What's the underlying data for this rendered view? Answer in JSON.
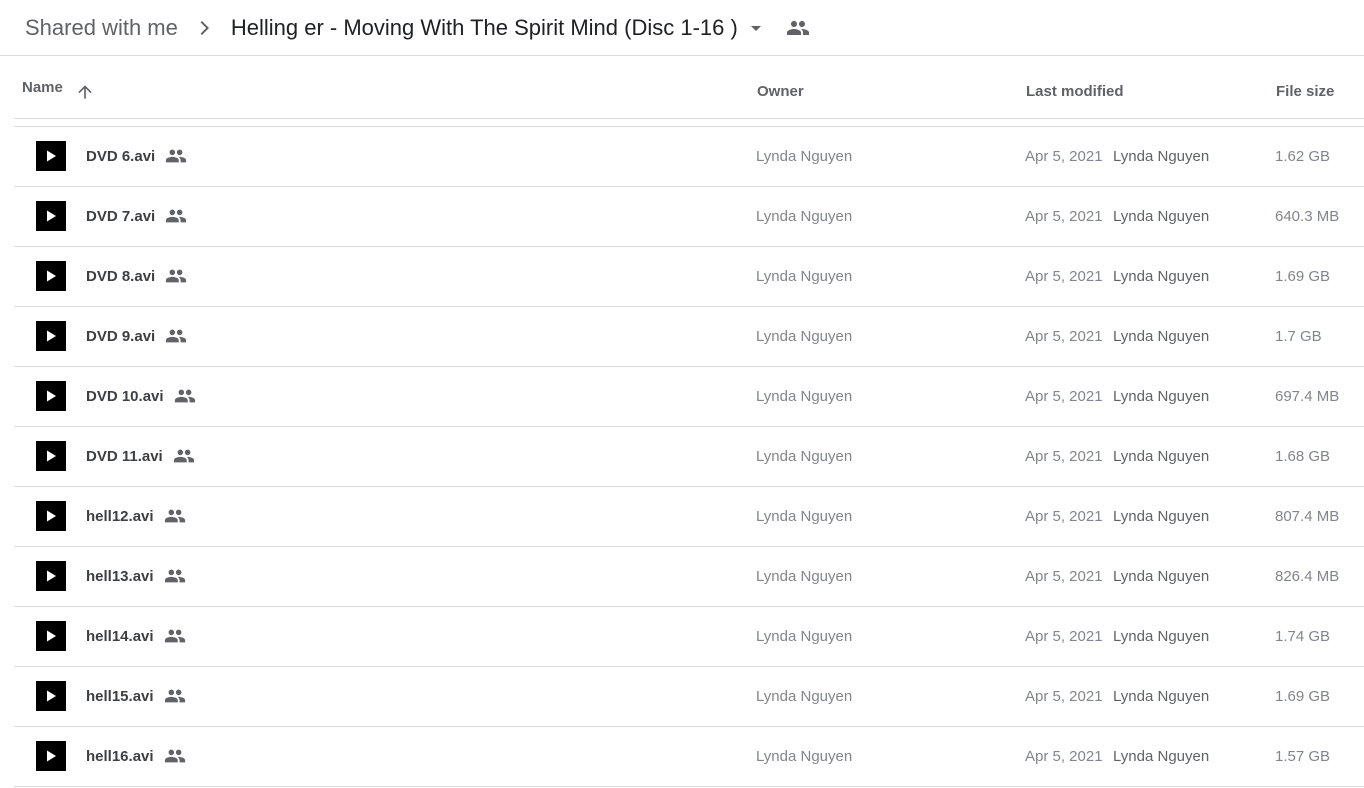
{
  "breadcrumb": {
    "root_label": "Shared with me",
    "current_label": "Helling er - Moving With The Spirit Mind (Disc 1-16 )",
    "separator_icon": "chevron-right-icon",
    "dropdown_icon": "arrow-drop-down-icon",
    "shared_icon": "people-icon"
  },
  "columns": {
    "name": "Name",
    "owner": "Owner",
    "last_modified": "Last modified",
    "file_size": "File size",
    "sort_icon": "arrow-up-icon"
  },
  "files": [
    {
      "name": "DVD 6.avi",
      "owner": "Lynda Nguyen",
      "modified_date": "Apr 5, 2021",
      "modified_by": "Lynda Nguyen",
      "size": "1.62 GB",
      "icon": "video-play-icon"
    },
    {
      "name": "DVD 7.avi",
      "owner": "Lynda Nguyen",
      "modified_date": "Apr 5, 2021",
      "modified_by": "Lynda Nguyen",
      "size": "640.3 MB",
      "icon": "video-play-icon"
    },
    {
      "name": "DVD 8.avi",
      "owner": "Lynda Nguyen",
      "modified_date": "Apr 5, 2021",
      "modified_by": "Lynda Nguyen",
      "size": "1.69 GB",
      "icon": "video-play-icon"
    },
    {
      "name": "DVD 9.avi",
      "owner": "Lynda Nguyen",
      "modified_date": "Apr 5, 2021",
      "modified_by": "Lynda Nguyen",
      "size": "1.7 GB",
      "icon": "video-play-icon"
    },
    {
      "name": "DVD 10.avi",
      "owner": "Lynda Nguyen",
      "modified_date": "Apr 5, 2021",
      "modified_by": "Lynda Nguyen",
      "size": "697.4 MB",
      "icon": "video-play-icon"
    },
    {
      "name": "DVD 11.avi",
      "owner": "Lynda Nguyen",
      "modified_date": "Apr 5, 2021",
      "modified_by": "Lynda Nguyen",
      "size": "1.68 GB",
      "icon": "video-play-icon"
    },
    {
      "name": "hell12.avi",
      "owner": "Lynda Nguyen",
      "modified_date": "Apr 5, 2021",
      "modified_by": "Lynda Nguyen",
      "size": "807.4 MB",
      "icon": "video-play-icon"
    },
    {
      "name": "hell13.avi",
      "owner": "Lynda Nguyen",
      "modified_date": "Apr 5, 2021",
      "modified_by": "Lynda Nguyen",
      "size": "826.4 MB",
      "icon": "video-play-icon"
    },
    {
      "name": "hell14.avi",
      "owner": "Lynda Nguyen",
      "modified_date": "Apr 5, 2021",
      "modified_by": "Lynda Nguyen",
      "size": "1.74 GB",
      "icon": "video-play-icon"
    },
    {
      "name": "hell15.avi",
      "owner": "Lynda Nguyen",
      "modified_date": "Apr 5, 2021",
      "modified_by": "Lynda Nguyen",
      "size": "1.69 GB",
      "icon": "video-play-icon"
    },
    {
      "name": "hell16.avi",
      "owner": "Lynda Nguyen",
      "modified_date": "Apr 5, 2021",
      "modified_by": "Lynda Nguyen",
      "size": "1.57 GB",
      "icon": "video-play-icon"
    }
  ],
  "colors": {
    "divider": "#dadce0",
    "icon_gray": "#5f6368",
    "secondary_text": "#80868b",
    "file_icon_bg": "#000000"
  }
}
